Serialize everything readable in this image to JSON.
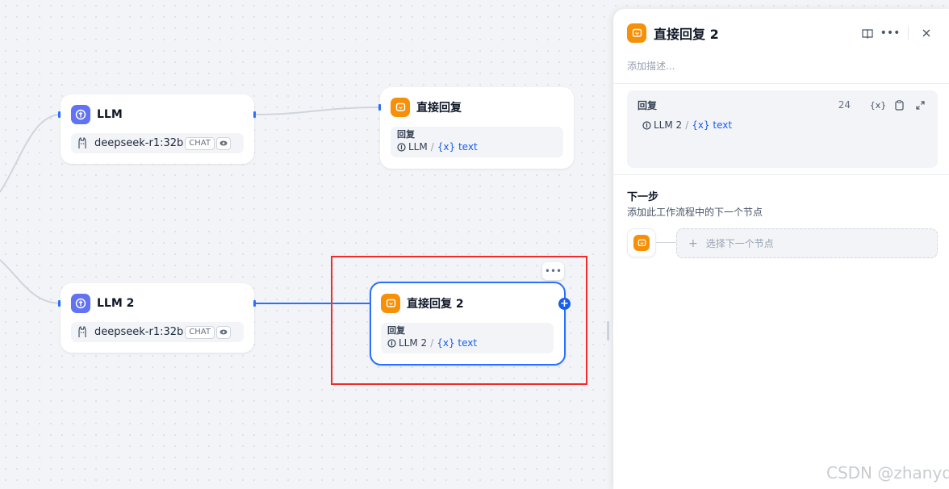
{
  "nodes": {
    "llm1": {
      "title": "LLM",
      "model": "deepseek-r1:32b",
      "badge": "CHAT"
    },
    "llm2": {
      "title": "LLM 2",
      "model": "deepseek-r1:32b",
      "badge": "CHAT"
    },
    "reply1": {
      "title": "直接回复",
      "reply_label": "回复",
      "var_source": "LLM",
      "var_sep": "/",
      "var_name": "{x} text"
    },
    "reply2": {
      "title": "直接回复 2",
      "reply_label": "回复",
      "var_source": "LLM 2",
      "var_sep": "/",
      "var_name": "{x} text"
    }
  },
  "panel": {
    "title": "直接回复 2",
    "description_placeholder": "添加描述...",
    "editor": {
      "label": "回复",
      "count": "24",
      "var_icon_label": "{x}",
      "var_source": "LLM 2",
      "var_sep": "/",
      "var_name": "{x} text"
    },
    "next_step": {
      "title": "下一步",
      "description": "添加此工作流程中的下一个节点",
      "select_placeholder": "选择下一个节点"
    }
  },
  "watermark": "CSDN @zhanyd",
  "colors": {
    "accent": "#155eef",
    "llm_icon": "#6172f3",
    "reply_icon": "#f79009",
    "selection": "#ef2b2b"
  }
}
